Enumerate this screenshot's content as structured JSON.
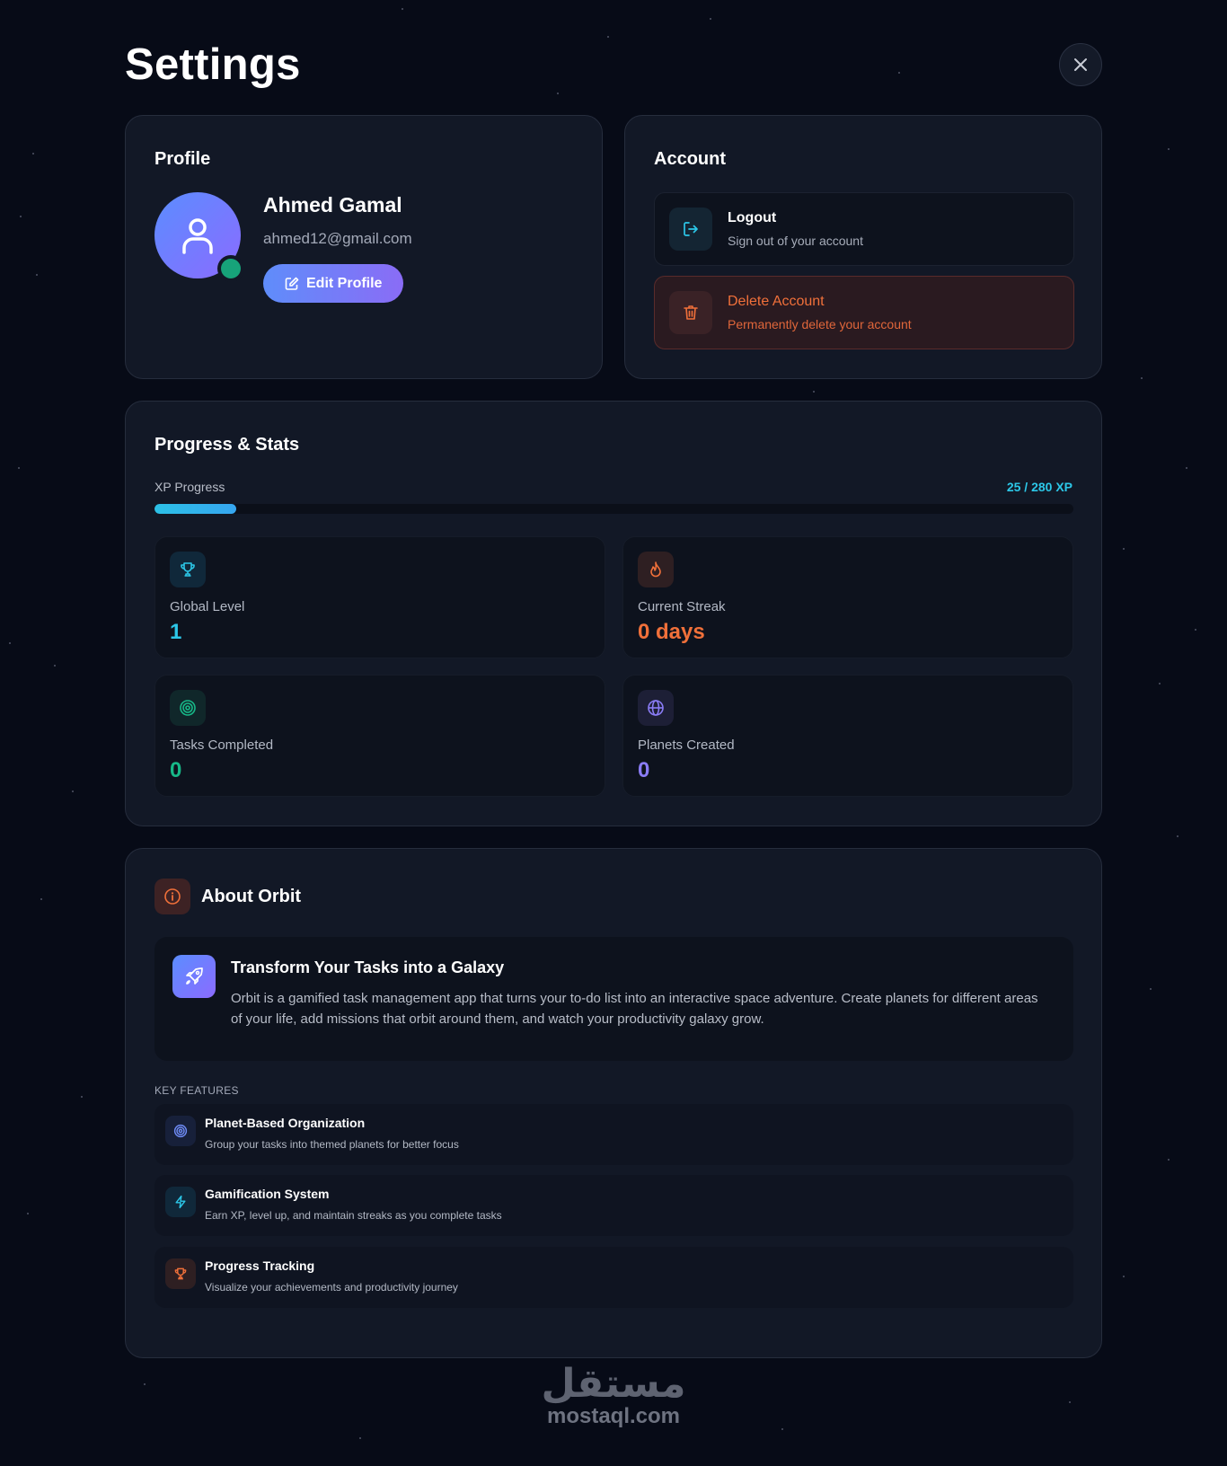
{
  "page": {
    "title": "Settings"
  },
  "profile": {
    "title": "Profile",
    "name": "Ahmed Gamal",
    "email": "ahmed12@gmail.com",
    "edit_label": "Edit Profile"
  },
  "account": {
    "title": "Account",
    "logout": {
      "label": "Logout",
      "sub": "Sign out of your account"
    },
    "delete": {
      "label": "Delete Account",
      "sub": "Permanently delete your account"
    }
  },
  "stats": {
    "title": "Progress & Stats",
    "xp_label": "XP Progress",
    "xp_value": "25 / 280 XP",
    "xp_current": 25,
    "xp_max": 280,
    "items": [
      {
        "label": "Global Level",
        "value": "1",
        "icon": "trophy-icon",
        "color": "#2cc7e8"
      },
      {
        "label": "Current Streak",
        "value": "0 days",
        "icon": "flame-icon",
        "color": "#f0703a"
      },
      {
        "label": "Tasks Completed",
        "value": "0",
        "icon": "target-icon",
        "color": "#17b888"
      },
      {
        "label": "Planets Created",
        "value": "0",
        "icon": "globe-icon",
        "color": "#8a7cf6"
      }
    ]
  },
  "about": {
    "title": "About Orbit",
    "intro_title": "Transform Your Tasks into a Galaxy",
    "intro_desc": "Orbit is a gamified task management app that turns your to-do list into an interactive space adventure. Create planets for different areas of your life, add missions that orbit around them, and watch your productivity galaxy grow.",
    "features_label": "KEY FEATURES",
    "features": [
      {
        "title": "Planet-Based Organization",
        "desc": "Group your tasks into themed planets for better focus",
        "icon": "target-icon"
      },
      {
        "title": "Gamification System",
        "desc": "Earn XP, level up, and maintain streaks as you complete tasks",
        "icon": "lightning-icon"
      },
      {
        "title": "Progress Tracking",
        "desc": "Visualize your achievements and productivity journey",
        "icon": "trophy-icon"
      }
    ]
  },
  "watermark": {
    "arabic": "مستقل",
    "latin": "mostaql.com"
  },
  "colors": {
    "accent": "#2cc7e8",
    "danger": "#f0703a",
    "success": "#17a37a",
    "purple": "#8a6cf6"
  }
}
